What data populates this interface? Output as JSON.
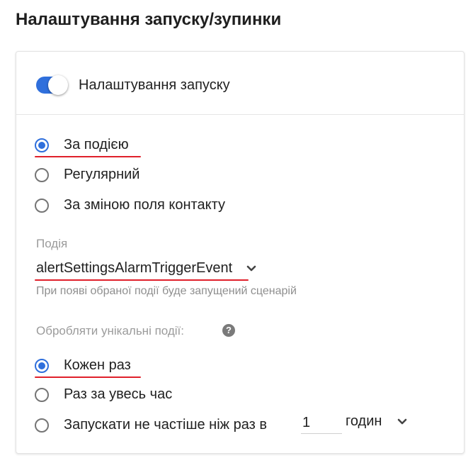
{
  "page_title": "Налаштування запуску/зупинки",
  "launch_settings": {
    "toggle_on": true,
    "label": "Налаштування запуску"
  },
  "trigger_type": {
    "options": [
      "За подією",
      "Регулярний",
      "За зміною поля контакту"
    ],
    "selected": "За подією"
  },
  "event": {
    "label": "Подія",
    "value": "alertSettingsAlarmTriggerEvent",
    "hint": "При появі обраної події буде запущений сценарій"
  },
  "unique_events": {
    "label": "Обробляти унікальні події:",
    "help_icon": "question-icon",
    "options": [
      "Кожен раз",
      "Раз за увесь час",
      "Запускати не частіше ніж раз в"
    ],
    "selected": "Кожен раз",
    "interval_value": "1",
    "interval_unit": "годин"
  },
  "colors": {
    "accent": "#2f6fdc",
    "highlight_underline": "#e0202b"
  }
}
